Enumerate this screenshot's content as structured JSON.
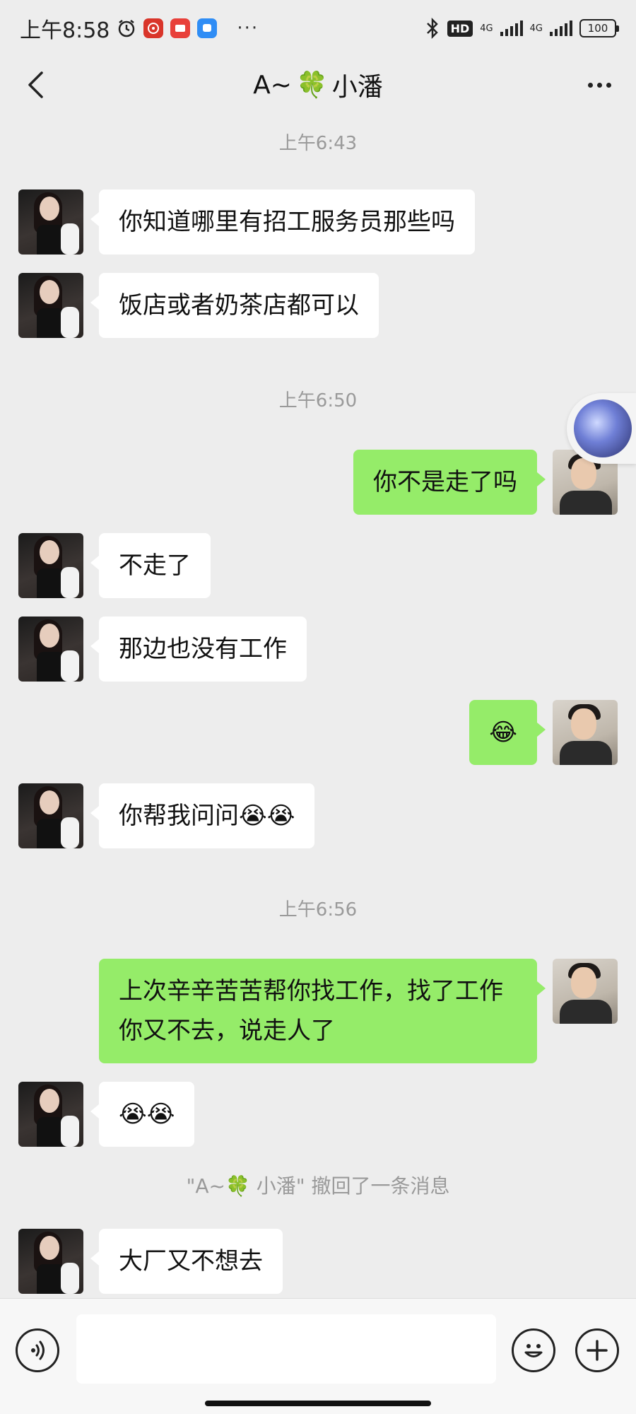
{
  "status_bar": {
    "time": "上午8:58",
    "network_1": "4G",
    "network_2": "4G",
    "hd": "HD",
    "battery": "100"
  },
  "nav": {
    "title_prefix": "A~",
    "title_suffix": "小潘",
    "clover_emoji": "🍀"
  },
  "timestamps": [
    "上午6:43",
    "上午6:50",
    "上午6:56"
  ],
  "messages": [
    {
      "side": "left",
      "text": "你知道哪里有招工服务员那些吗"
    },
    {
      "side": "left",
      "text": "饭店或者奶茶店都可以"
    },
    {
      "side": "right",
      "text": "你不是走了吗"
    },
    {
      "side": "left",
      "text": "不走了"
    },
    {
      "side": "left",
      "text": "那边也没有工作"
    },
    {
      "side": "right",
      "text": "😂"
    },
    {
      "side": "left",
      "text": "你帮我问问😭😭"
    },
    {
      "side": "right",
      "text": "上次辛辛苦苦帮你找工作，找了工作你又不去，说走人了"
    },
    {
      "side": "left",
      "text": "😭😭"
    },
    {
      "side": "left",
      "text": "大厂又不想去"
    }
  ],
  "recall_notice": "\"A~🍀 小潘\" 撤回了一条消息",
  "input": {
    "placeholder": ""
  }
}
